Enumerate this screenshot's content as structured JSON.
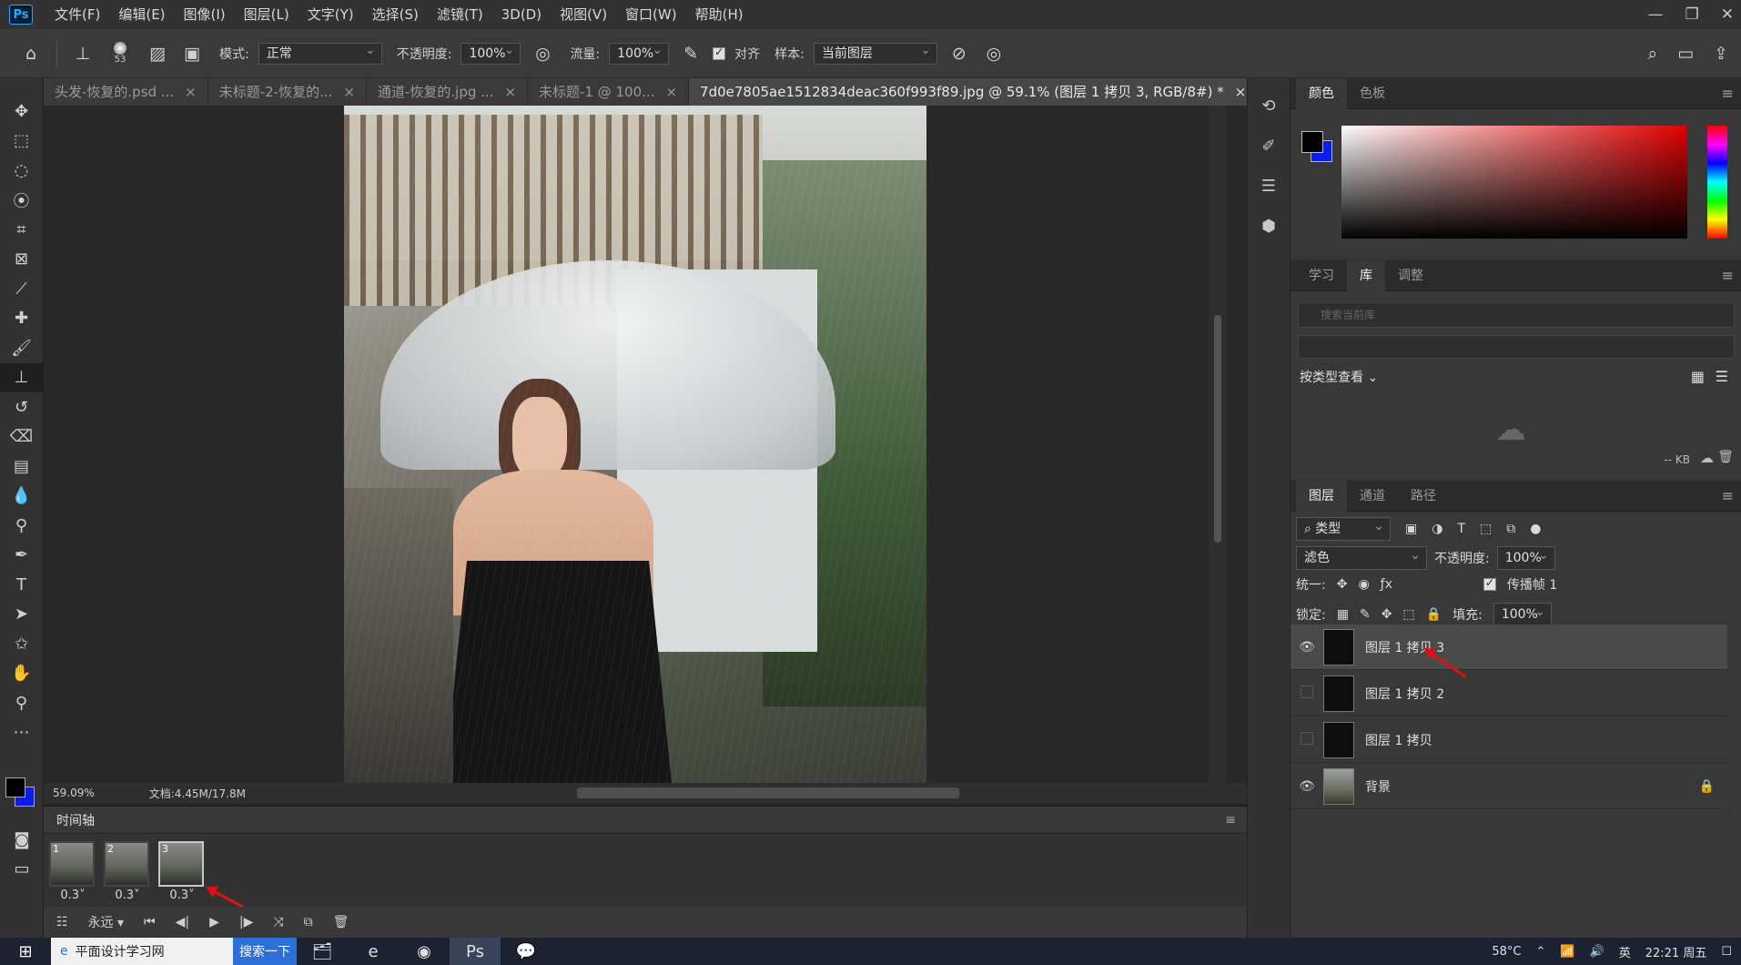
{
  "app": {
    "logo": "Ps"
  },
  "menu": [
    "文件(F)",
    "编辑(E)",
    "图像(I)",
    "图层(L)",
    "文字(Y)",
    "选择(S)",
    "滤镜(T)",
    "3D(D)",
    "视图(V)",
    "窗口(W)",
    "帮助(H)"
  ],
  "options": {
    "brush_size": "53",
    "mode_label": "模式:",
    "mode_value": "正常",
    "opacity_label": "不透明度:",
    "opacity_value": "100%",
    "flow_label": "流量:",
    "flow_value": "100%",
    "align_label": "对齐",
    "sample_label": "样本:",
    "sample_value": "当前图层"
  },
  "doc_tabs": [
    {
      "label": "头发-恢复的.psd ...",
      "close": "×"
    },
    {
      "label": "未标题-2-恢复的...",
      "close": "×"
    },
    {
      "label": "通道-恢复的.jpg ...",
      "close": "×"
    },
    {
      "label": "未标题-1 @ 100...",
      "close": "×"
    },
    {
      "label": "7d0e7805ae1512834deac360f993f89.jpg  @ 59.1% (图层 1 拷贝 3, RGB/8#) *",
      "close": "×"
    }
  ],
  "status": {
    "zoom": "59.09%",
    "doc": "文档:4.45M/17.8M"
  },
  "timeline": {
    "title": "时间轴",
    "frames": [
      {
        "num": "1",
        "delay": "0.3"
      },
      {
        "num": "2",
        "delay": "0.3"
      },
      {
        "num": "3",
        "delay": "0.3"
      }
    ],
    "loop": "永远"
  },
  "color_panel": {
    "tabs": [
      "颜色",
      "色板"
    ]
  },
  "library_panel": {
    "tabs": [
      "学习",
      "库",
      "调整"
    ],
    "search_placeholder": "搜索当前库",
    "view_label": "按类型查看",
    "size": "-- KB"
  },
  "layers_panel": {
    "tabs": [
      "图层",
      "通道",
      "路径"
    ],
    "filter_kind": "类型",
    "blend_mode": "滤色",
    "opacity_label": "不透明度:",
    "opacity_value": "100%",
    "unify_label": "统一:",
    "propagate_label": "传播帧 1",
    "lock_label": "锁定:",
    "fill_label": "填充:",
    "fill_value": "100%",
    "layers": [
      {
        "name": "图层 1 拷贝 3",
        "visible": true,
        "selected": true
      },
      {
        "name": "图层 1 拷贝 2",
        "visible": false,
        "selected": false
      },
      {
        "name": "图层 1 拷贝",
        "visible": false,
        "selected": false
      },
      {
        "name": "背景",
        "visible": true,
        "selected": false,
        "locked": true
      }
    ]
  },
  "taskbar": {
    "search_text": "平面设计学习网",
    "search_btn": "搜索一下",
    "temp": "58°C",
    "time": "22:21 周五",
    "ime": "英"
  },
  "colors": {
    "foreground": "#000000",
    "background": "#0b1cf0",
    "accent": "#31a8ff",
    "arrow": "#e01010"
  }
}
